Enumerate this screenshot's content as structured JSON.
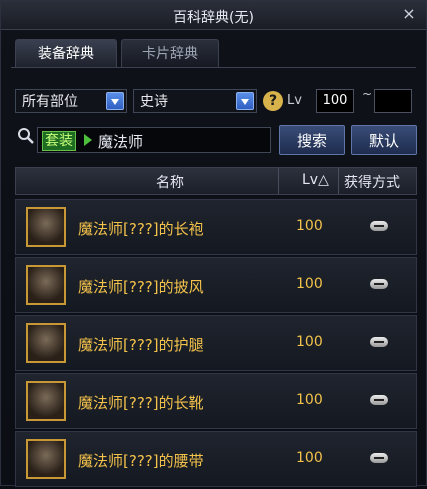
{
  "window": {
    "title": "百科辞典(无)",
    "close_label": "×"
  },
  "tabs": [
    {
      "label": "装备辞典",
      "active": true
    },
    {
      "label": "卡片辞典",
      "active": false
    }
  ],
  "filters": {
    "part": "所有部位",
    "grade": "史诗",
    "help": "?",
    "lv_label": "Lv",
    "lv_min": "100",
    "lv_max": "",
    "range_sep": "~"
  },
  "search": {
    "tag": "套装",
    "query": "魔法师",
    "search_button": "搜索",
    "default_button": "默认"
  },
  "table": {
    "columns": {
      "name": "名称",
      "lv": "Lv△",
      "source": "获得方式"
    },
    "rows": [
      {
        "name": "魔法师[???]的长袍",
        "lv": "100",
        "icon": "robe-icon"
      },
      {
        "name": "魔法师[???]的披风",
        "lv": "100",
        "icon": "cloak-icon"
      },
      {
        "name": "魔法师[???]的护腿",
        "lv": "100",
        "icon": "leggings-icon"
      },
      {
        "name": "魔法师[???]的长靴",
        "lv": "100",
        "icon": "boots-icon"
      },
      {
        "name": "魔法师[???]的腰带",
        "lv": "100",
        "icon": "belt-icon"
      }
    ]
  },
  "colors": {
    "item_gold": "#f3c24a",
    "accent_blue": "#3b66c6"
  }
}
